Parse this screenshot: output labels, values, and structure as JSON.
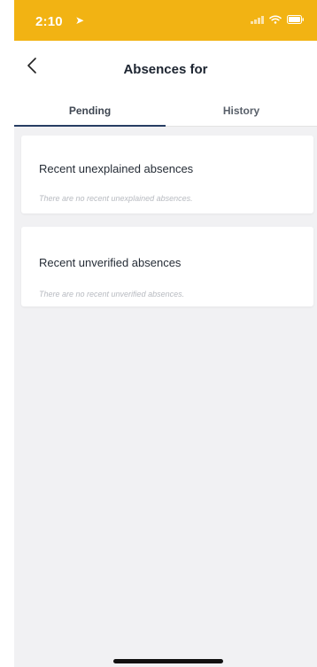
{
  "status_bar": {
    "time": "2:10",
    "background_color": "#f2b313",
    "icons": [
      "location-arrow-icon",
      "signal-bars-icon",
      "wifi-icon",
      "battery-icon"
    ]
  },
  "header": {
    "title": "Absences for",
    "back_icon": "chevron-left-icon"
  },
  "tabs": [
    {
      "label": "Pending",
      "active": true
    },
    {
      "label": "History",
      "active": false
    }
  ],
  "sections": [
    {
      "title": "Recent unexplained absences",
      "empty_message": "There are no recent unexplained absences."
    },
    {
      "title": "Recent unverified absences",
      "empty_message": "There are no recent unverified absences."
    }
  ],
  "colors": {
    "accent_tab_indicator": "#273d63",
    "content_background": "#f1f1f3"
  }
}
